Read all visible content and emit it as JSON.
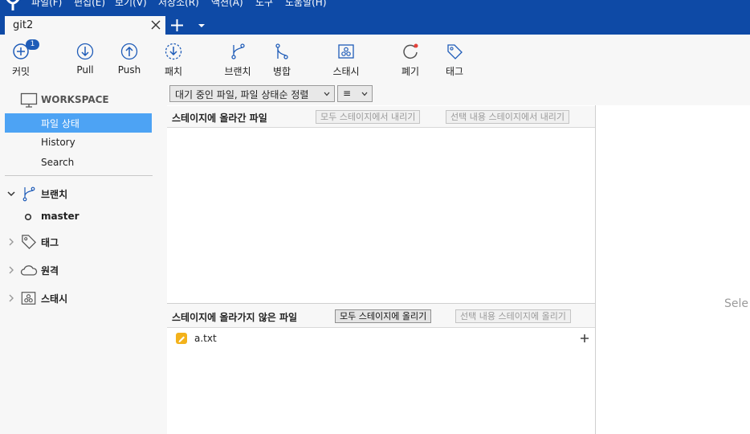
{
  "menu": {
    "items": [
      {
        "label": "파일(F)"
      },
      {
        "label": "편집(E)"
      },
      {
        "label": "보기(V)"
      },
      {
        "label": "저장소(R)"
      },
      {
        "label": "액션(A)"
      },
      {
        "label": "도구"
      },
      {
        "label": "도움말(H)"
      }
    ]
  },
  "tabs": {
    "active": "git2",
    "close_icon": "close-icon",
    "add_icon": "plus-icon"
  },
  "toolbar": {
    "commit": {
      "label": "커밋",
      "badge": "1"
    },
    "pull": {
      "label": "Pull"
    },
    "push": {
      "label": "Push"
    },
    "patch": {
      "label": "패치"
    },
    "branch": {
      "label": "브랜치"
    },
    "merge": {
      "label": "병합"
    },
    "stash": {
      "label": "스태시"
    },
    "discard": {
      "label": "폐기"
    },
    "tag": {
      "label": "태그"
    }
  },
  "sidebar": {
    "workspace": "WORKSPACE",
    "file_status": "파일 상태",
    "history": "History",
    "search": "Search",
    "branches": "브랜치",
    "current_branch": "master",
    "tags": "태그",
    "remotes": "원격",
    "stashes": "스태시"
  },
  "main": {
    "sort_select": "대기 중인 파일, 파일 상태순 정렬",
    "view_select": "≡",
    "staged": {
      "title": "스테이지에 올라간 파일",
      "unstage_all": "모두 스테이지에서 내리기",
      "unstage_selected": "선택 내용 스테이지에서 내리기"
    },
    "unstaged": {
      "title": "스테이지에 올라가지 않은 파일",
      "stage_all": "모두 스테이지에 올리기",
      "stage_selected": "선택 내용 스테이지에 올리기",
      "files": [
        {
          "name": "a.txt",
          "status_color": "#f3b21b"
        }
      ]
    },
    "right_pane_text": "Sele"
  },
  "colors": {
    "accent": "#0e4aa6",
    "selection": "#4da3f4",
    "modified": "#f3b21b"
  }
}
